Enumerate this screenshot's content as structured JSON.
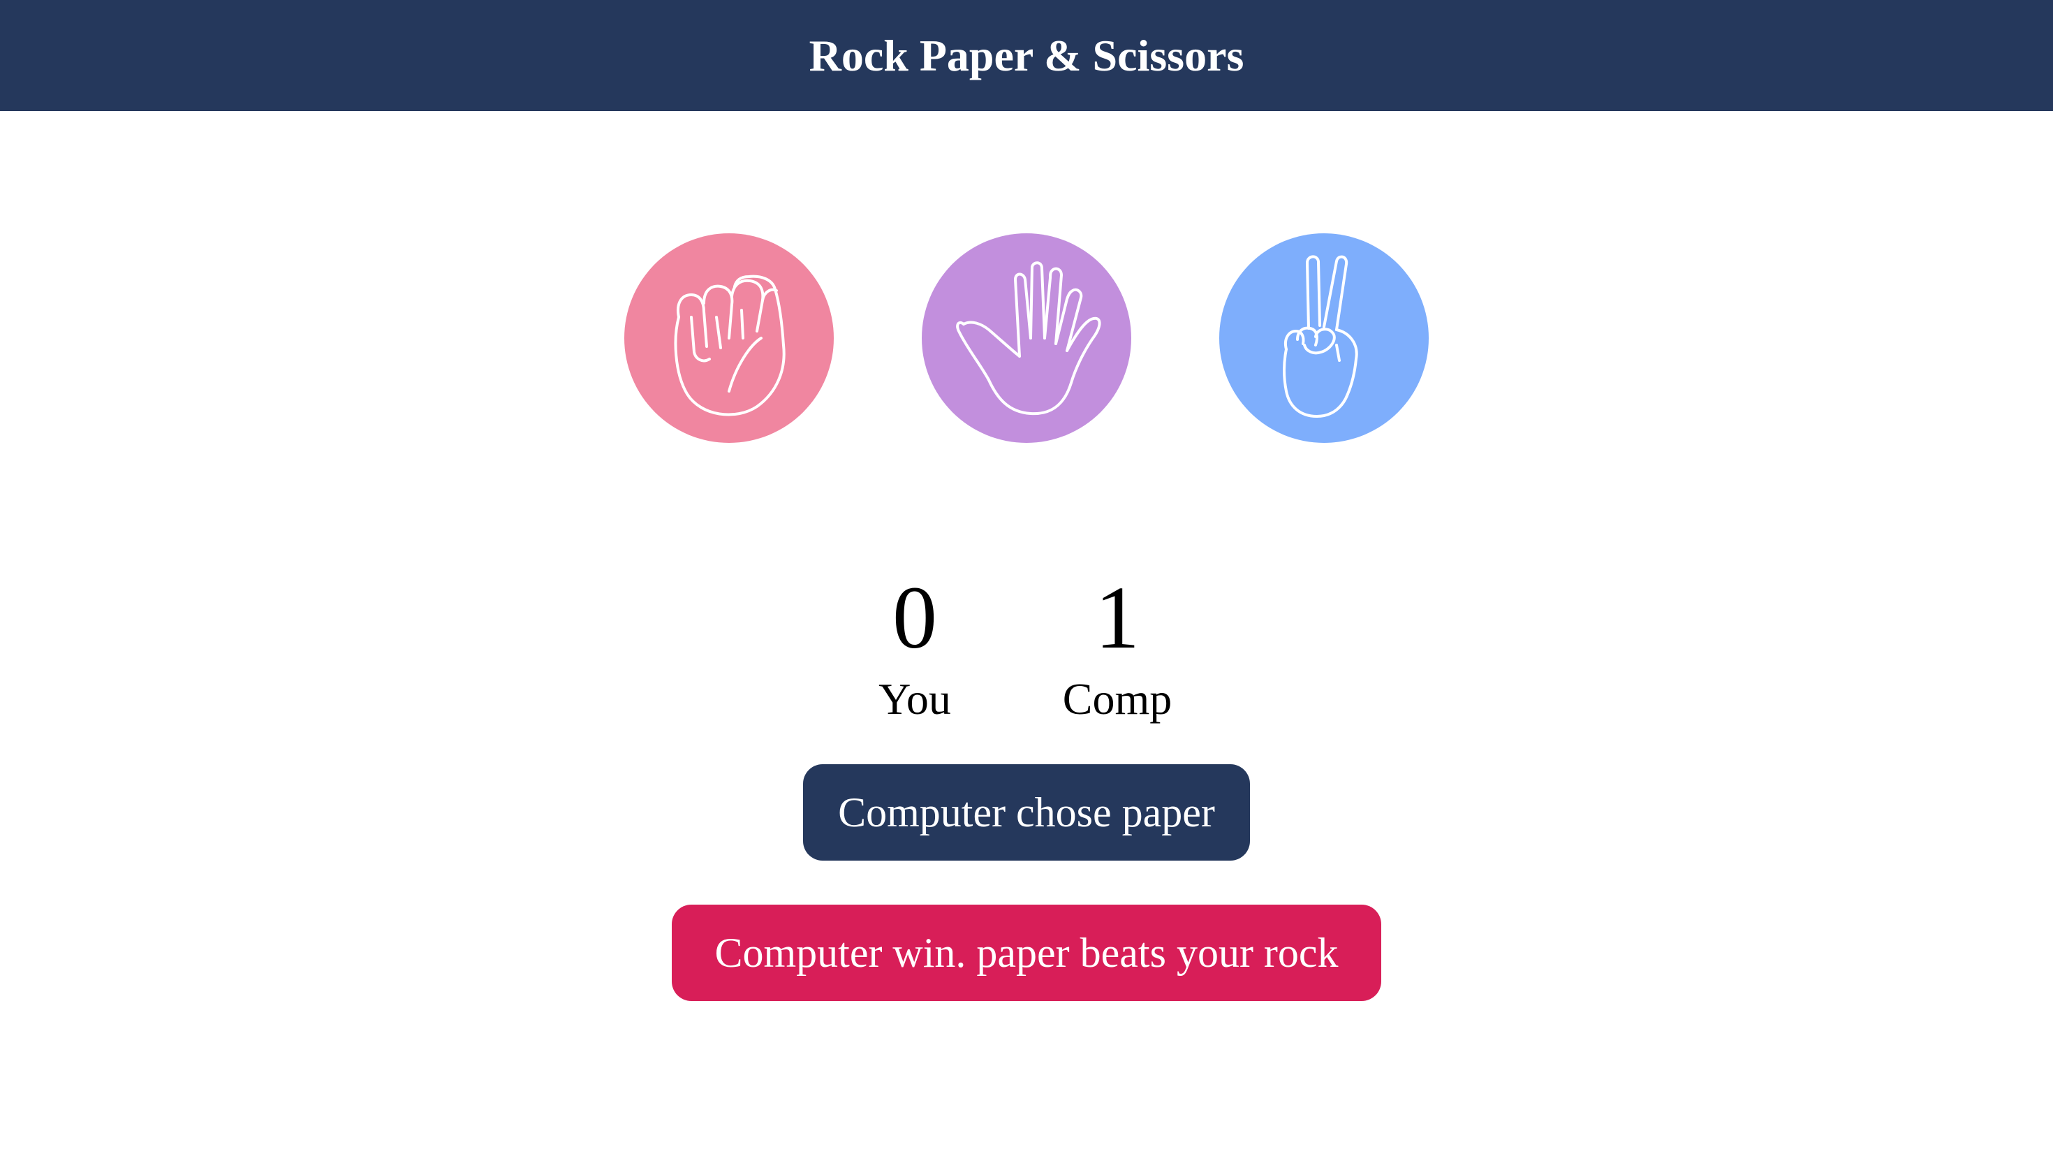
{
  "header": {
    "title": "Rock Paper & Scissors"
  },
  "choices": [
    {
      "name": "rock",
      "icon": "fist-icon",
      "color": "#f086a0"
    },
    {
      "name": "paper",
      "icon": "open-hand-icon",
      "color": "#c28fdd"
    },
    {
      "name": "scissors",
      "icon": "peace-hand-icon",
      "color": "#7eaefc"
    }
  ],
  "scoreboard": {
    "you": {
      "value": "0",
      "label": "You"
    },
    "comp": {
      "value": "1",
      "label": "Comp"
    }
  },
  "messages": {
    "computer_choice": "Computer chose paper",
    "result": "Computer win. paper beats your rock"
  },
  "colors": {
    "header_bg": "#25385c",
    "choice_badge_bg": "#25385c",
    "result_badge_bg": "#d81e58"
  }
}
